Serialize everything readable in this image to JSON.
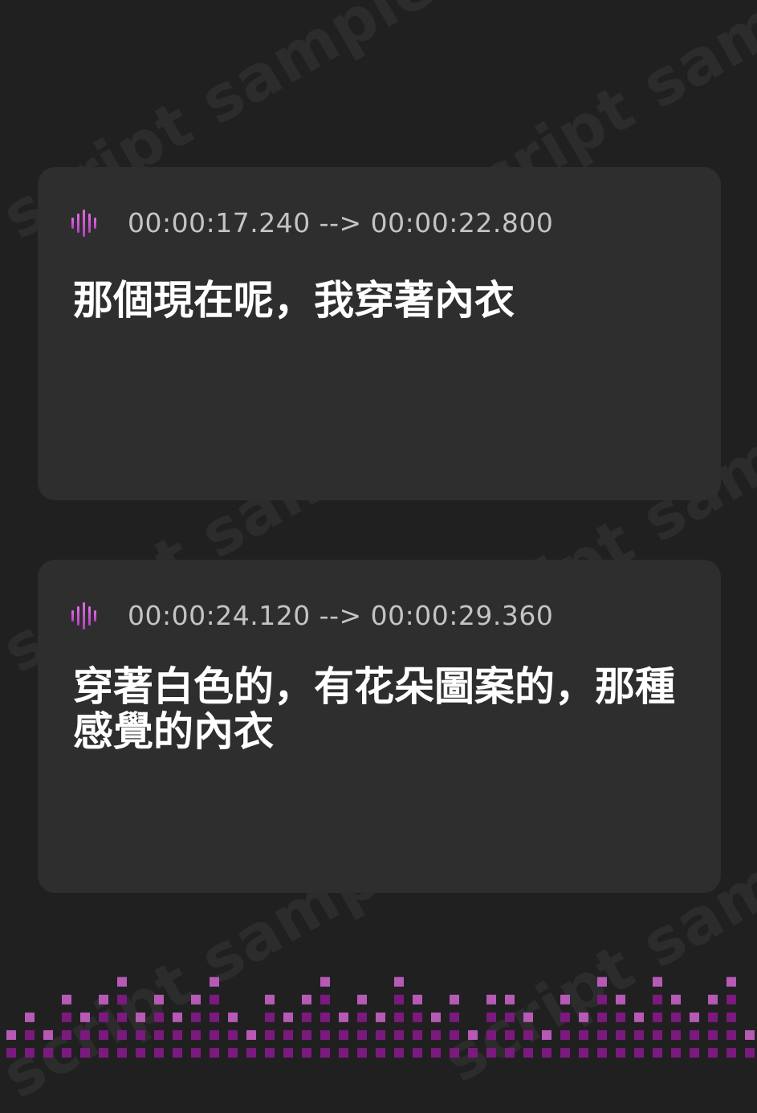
{
  "watermark": {
    "text": "script sample"
  },
  "cards": [
    {
      "icon": "audio-wave-icon",
      "timestamp": "00:00:17.240 --> 00:00:22.800",
      "text": "那個現在呢，我穿著內衣"
    },
    {
      "icon": "audio-wave-icon",
      "timestamp": "00:00:24.120 --> 00:00:29.360",
      "text": "穿著白色的，有花朵圖案的，那種感覺的內衣"
    }
  ],
  "colors": {
    "background": "#202020",
    "card": "#2e2e2e",
    "accent": "#c94ad3",
    "equalizer": "#7a1a7e",
    "equalizer_highlight": "#b75ab5"
  },
  "equalizer": {
    "levels": [
      1,
      2,
      1,
      3,
      2,
      3,
      4,
      2,
      3,
      2,
      3,
      4,
      2,
      1,
      3,
      2,
      3,
      4,
      2,
      3,
      2,
      4,
      3,
      2,
      3,
      1,
      3,
      3,
      2,
      1,
      3,
      2,
      4,
      3,
      2,
      4,
      3,
      2,
      3,
      4,
      1
    ]
  }
}
